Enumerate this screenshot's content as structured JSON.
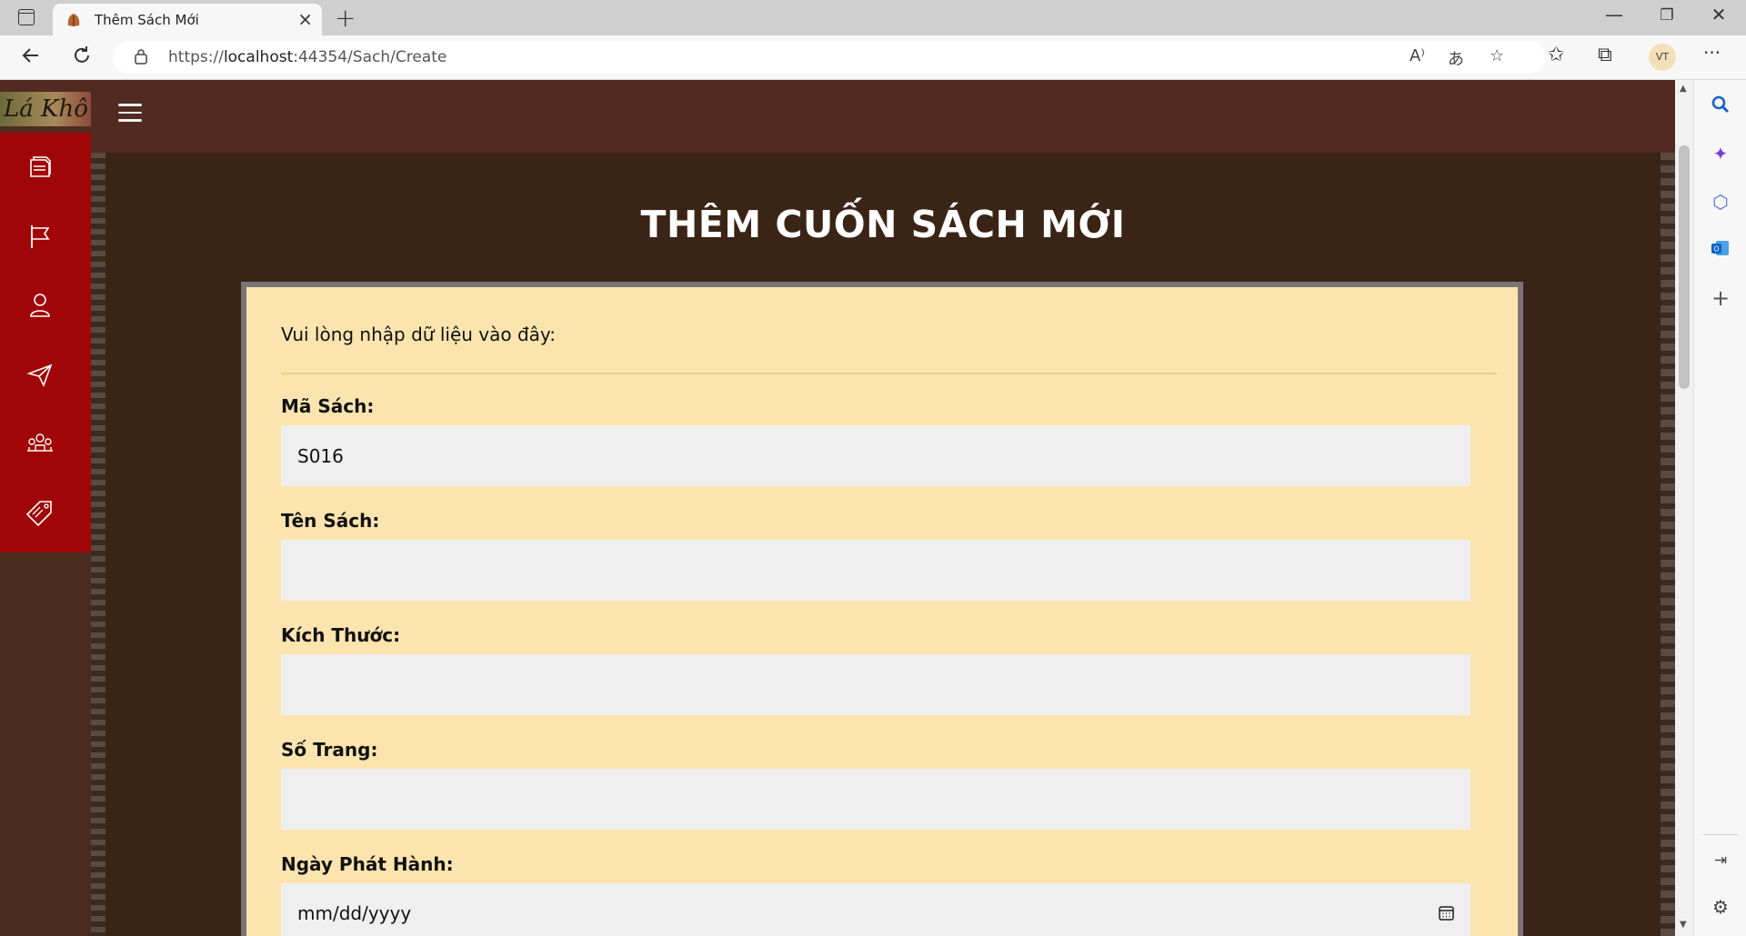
{
  "browser": {
    "tab_title": "Thêm Sách Mới",
    "url_prefix": "https://",
    "url_host": "localhost",
    "url_rest": ":44354/Sach/Create",
    "profile_initials": "VT"
  },
  "site": {
    "logo_text": "Lá Khô",
    "sidenav": [
      "book-icon",
      "flag-icon",
      "user-icon",
      "send-icon",
      "team-icon",
      "tag-icon"
    ]
  },
  "page": {
    "title": "THÊM CUỐN SÁCH MỚI",
    "intro": "Vui lòng nhập dữ liệu vào đây:"
  },
  "form": {
    "ma_sach": {
      "label": "Mã Sách:",
      "value": "S016"
    },
    "ten_sach": {
      "label": "Tên Sách:",
      "value": ""
    },
    "kich_thuoc": {
      "label": "Kích Thước:",
      "value": ""
    },
    "so_trang": {
      "label": "Số Trang:",
      "value": ""
    },
    "ngay_phat_hanh": {
      "label": "Ngày Phát Hành:",
      "placeholder": "mm/dd/yyyy"
    }
  }
}
